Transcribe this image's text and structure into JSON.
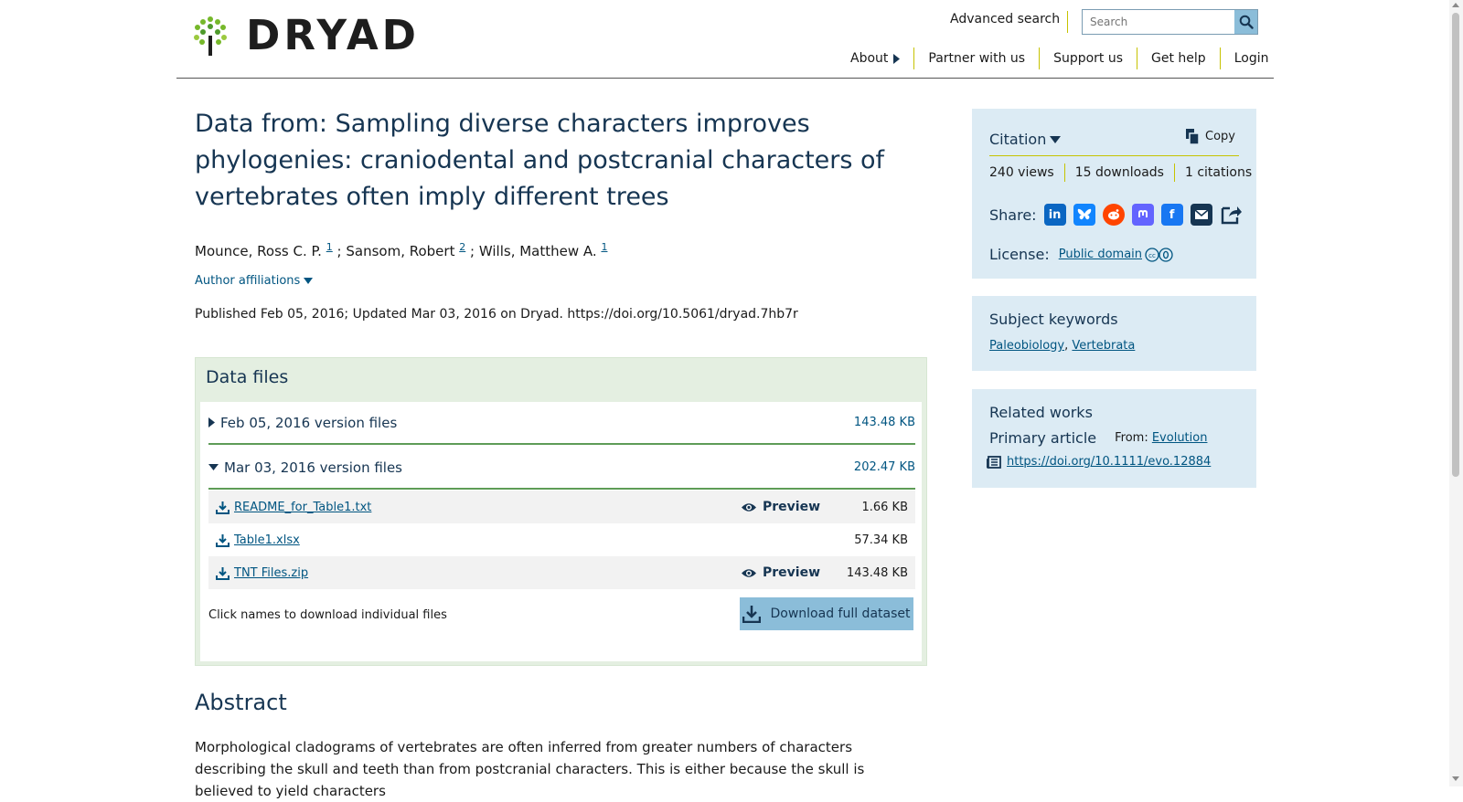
{
  "header": {
    "logo_text": "DRYAD",
    "advanced_search": "Advanced search",
    "search_placeholder": "Search",
    "nav": [
      {
        "label": "About"
      },
      {
        "label": "Partner with us"
      },
      {
        "label": "Support us"
      },
      {
        "label": "Get help"
      },
      {
        "label": "Login"
      }
    ]
  },
  "dataset": {
    "title": "Data from: Sampling diverse characters improves phylogenies: craniodental and postcranial characters of vertebrates often imply different trees",
    "authors": [
      {
        "name": "Mounce, Ross C. P.",
        "affiliation": "1"
      },
      {
        "name": "Sansom, Robert",
        "affiliation": "2"
      },
      {
        "name": "Wills, Matthew A.",
        "affiliation": "1"
      }
    ],
    "author_separator": ";",
    "author_affiliations_label": "Author affiliations",
    "published": "Published Feb 05, 2016; Updated Mar 03, 2016 on Dryad. https://doi.org/10.5061/dryad.7hb7r"
  },
  "data_files": {
    "title": "Data files",
    "versions": [
      {
        "label": "Feb 05, 2016 version files",
        "size": "143.48 KB",
        "expanded": false
      },
      {
        "label": "Mar 03, 2016 version files",
        "size": "202.47 KB",
        "expanded": true
      }
    ],
    "files": [
      {
        "name": "README_for_Table1.txt",
        "size": "1.66 KB",
        "preview": "Preview"
      },
      {
        "name": "Table1.xlsx",
        "size": "57.34 KB",
        "preview": ""
      },
      {
        "name": "TNT Files.zip",
        "size": "143.48 KB",
        "preview": "Preview"
      }
    ],
    "hint": "Click names to download individual files",
    "download_full": "Download full dataset"
  },
  "abstract": {
    "title": "Abstract",
    "body": "Morphological cladograms of vertebrates are often inferred from greater numbers of characters describing the skull and teeth than from postcranial characters. This is either because the skull is believed to yield characters"
  },
  "sidebar": {
    "citation": {
      "title": "Citation",
      "copy": "Copy",
      "views": "240 views",
      "downloads": "15 downloads",
      "citations": "1 citations",
      "share_label": "Share:",
      "share_icons": [
        "linkedin-icon",
        "bluesky-icon",
        "reddit-icon",
        "mastodon-icon",
        "facebook-icon",
        "email-icon",
        "share-icon"
      ],
      "license_label": "License:",
      "license_value": "Public domain"
    },
    "keywords": {
      "title": "Subject keywords",
      "items": [
        "Paleobiology",
        "Vertebrata"
      ],
      "separator": ","
    },
    "related": {
      "title": "Related works",
      "type": "Primary article",
      "from_label": "From:",
      "from_value": "Evolution",
      "doi": "https://doi.org/10.1111/evo.12884"
    }
  },
  "colors": {
    "heading": "#163552",
    "link": "#005581",
    "accent_yellow": "#c6c300",
    "files_bg": "#e4efe1",
    "files_rule": "#5e9c57",
    "sidebar_bg": "#dcebf4",
    "button_bg": "#8bbdd9"
  }
}
